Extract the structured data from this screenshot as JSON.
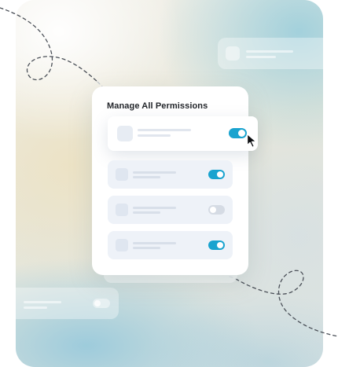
{
  "permissions_card": {
    "title": "Manage All Permissions",
    "rows": [
      {
        "enabled": true,
        "highlighted": true
      },
      {
        "enabled": true,
        "highlighted": false
      },
      {
        "enabled": false,
        "highlighted": false
      },
      {
        "enabled": true,
        "highlighted": false
      }
    ]
  },
  "colors": {
    "toggle_on": "#19a3cf",
    "toggle_off": "#d5dbe4",
    "row_background": "#eef2f8",
    "card_background": "#ffffff",
    "title_text": "#23262b"
  },
  "icons": {
    "pointer": "mouse-pointer-icon"
  }
}
